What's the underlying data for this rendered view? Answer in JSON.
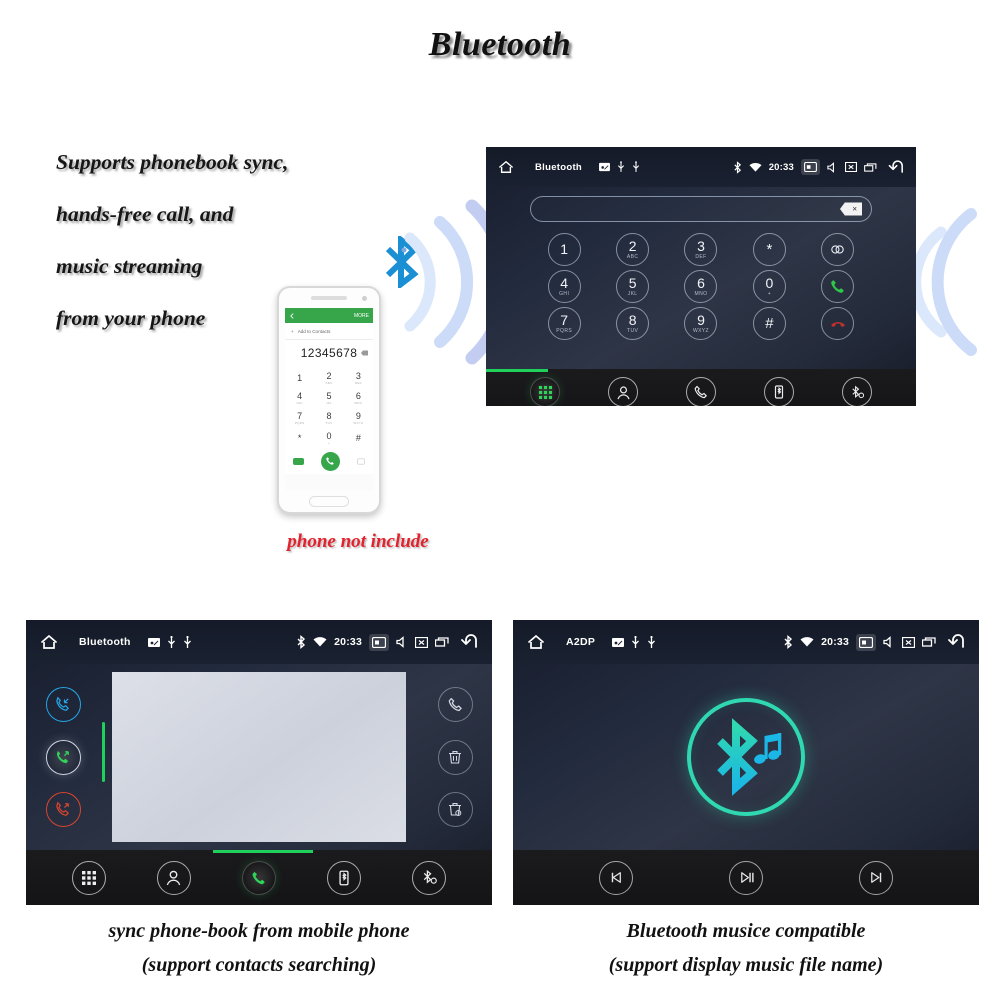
{
  "title": "Bluetooth",
  "features": {
    "lines": [
      "Supports phonebook sync,",
      "hands-free call, and",
      "music streaming",
      "from your phone"
    ]
  },
  "phone_mockup": {
    "note": "phone not include",
    "topbar_more": "MORE",
    "add_to_contacts": "Add to Contacts",
    "dialed_number": "12345678",
    "keys": [
      {
        "digit": "1",
        "sub": ""
      },
      {
        "digit": "2",
        "sub": "ABC"
      },
      {
        "digit": "3",
        "sub": "DEF"
      },
      {
        "digit": "4",
        "sub": "GHI"
      },
      {
        "digit": "5",
        "sub": "JKL"
      },
      {
        "digit": "6",
        "sub": "MNO"
      },
      {
        "digit": "7",
        "sub": "PQRS"
      },
      {
        "digit": "8",
        "sub": "TUV"
      },
      {
        "digit": "9",
        "sub": "WXYZ"
      },
      {
        "digit": "*",
        "sub": ""
      },
      {
        "digit": "0",
        "sub": "+"
      },
      {
        "digit": "#",
        "sub": ""
      }
    ]
  },
  "head_unit_dialer": {
    "status": {
      "title": "Bluetooth",
      "time": "20:33"
    },
    "input_value": "",
    "keypad": [
      {
        "digit": "1",
        "sub": ""
      },
      {
        "digit": "2",
        "sub": "ABC"
      },
      {
        "digit": "3",
        "sub": "DEF"
      },
      {
        "digit": "*",
        "sub": ""
      },
      {
        "digit": "",
        "sub": ""
      },
      {
        "digit": "4",
        "sub": "GHI"
      },
      {
        "digit": "5",
        "sub": "JKL"
      },
      {
        "digit": "6",
        "sub": "MNO"
      },
      {
        "digit": "0",
        "sub": "+"
      },
      {
        "digit": "",
        "sub": ""
      },
      {
        "digit": "7",
        "sub": "PQRS"
      },
      {
        "digit": "8",
        "sub": "TUV"
      },
      {
        "digit": "9",
        "sub": "WXYZ"
      },
      {
        "digit": "#",
        "sub": ""
      },
      {
        "digit": "",
        "sub": ""
      }
    ],
    "nav": [
      "dialpad-icon",
      "contacts-icon",
      "call-history-icon",
      "phone-sync-icon",
      "bluetooth-settings-icon"
    ],
    "active_nav": "dialpad-icon"
  },
  "head_unit_calllog": {
    "status": {
      "title": "Bluetooth",
      "time": "20:33"
    },
    "filters": [
      "incoming-call-icon",
      "outgoing-call-icon",
      "missed-call-icon"
    ],
    "active_filter": "outgoing-call-icon",
    "actions": [
      "dial-icon",
      "delete-icon",
      "delete-all-icon"
    ],
    "nav": [
      "dialpad-icon",
      "contacts-icon",
      "call-history-icon",
      "phone-sync-icon",
      "bluetooth-settings-icon"
    ],
    "active_nav": "call-history-icon",
    "caption_line1": "sync phone-book from mobile phone",
    "caption_line2": "(support contacts searching)"
  },
  "head_unit_a2dp": {
    "status": {
      "title": "A2DP",
      "time": "20:33"
    },
    "controls": [
      "previous-track-icon",
      "play-pause-icon",
      "next-track-icon"
    ],
    "caption_line1": "Bluetooth musice compatible",
    "caption_line2": "(support display music file name)"
  },
  "colors": {
    "accent_green": "#1fd15a",
    "bluetooth_blue": "#1a8fd4",
    "a2dp_teal": "#2fd8b0",
    "note_red": "#e2222e"
  }
}
